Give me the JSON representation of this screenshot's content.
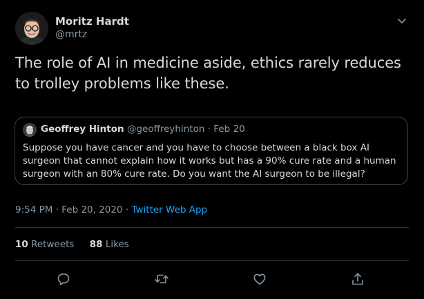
{
  "tweet": {
    "author_name": "Moritz Hardt",
    "author_handle": "@mrtz",
    "text": "The role of AI in medicine aside, ethics rarely reduces to trolley problems like these.",
    "timestamp": "9:54 PM · Feb 20, 2020",
    "separator": "·",
    "source_app": "Twitter Web App"
  },
  "quoted_tweet": {
    "author_name": "Geoffrey Hinton",
    "author_handle": "@geoffreyhinton",
    "separator": "·",
    "date": "Feb 20",
    "text": "Suppose you have cancer and you have to choose between a black box AI surgeon that cannot explain how it works but has a 90% cure rate and a human surgeon with an 80% cure rate. Do you want the AI surgeon to be illegal?"
  },
  "stats": {
    "retweets_count": "10",
    "retweets_label": "Retweets",
    "likes_count": "88",
    "likes_label": "Likes"
  },
  "actions": {
    "icons": [
      "reply-icon",
      "retweet-icon",
      "like-icon",
      "share-icon"
    ]
  },
  "colors": {
    "background": "#000000",
    "text_primary": "#d9d9d9",
    "text_secondary": "#8899a6",
    "accent": "#1da1f2",
    "border": "#38444d"
  }
}
